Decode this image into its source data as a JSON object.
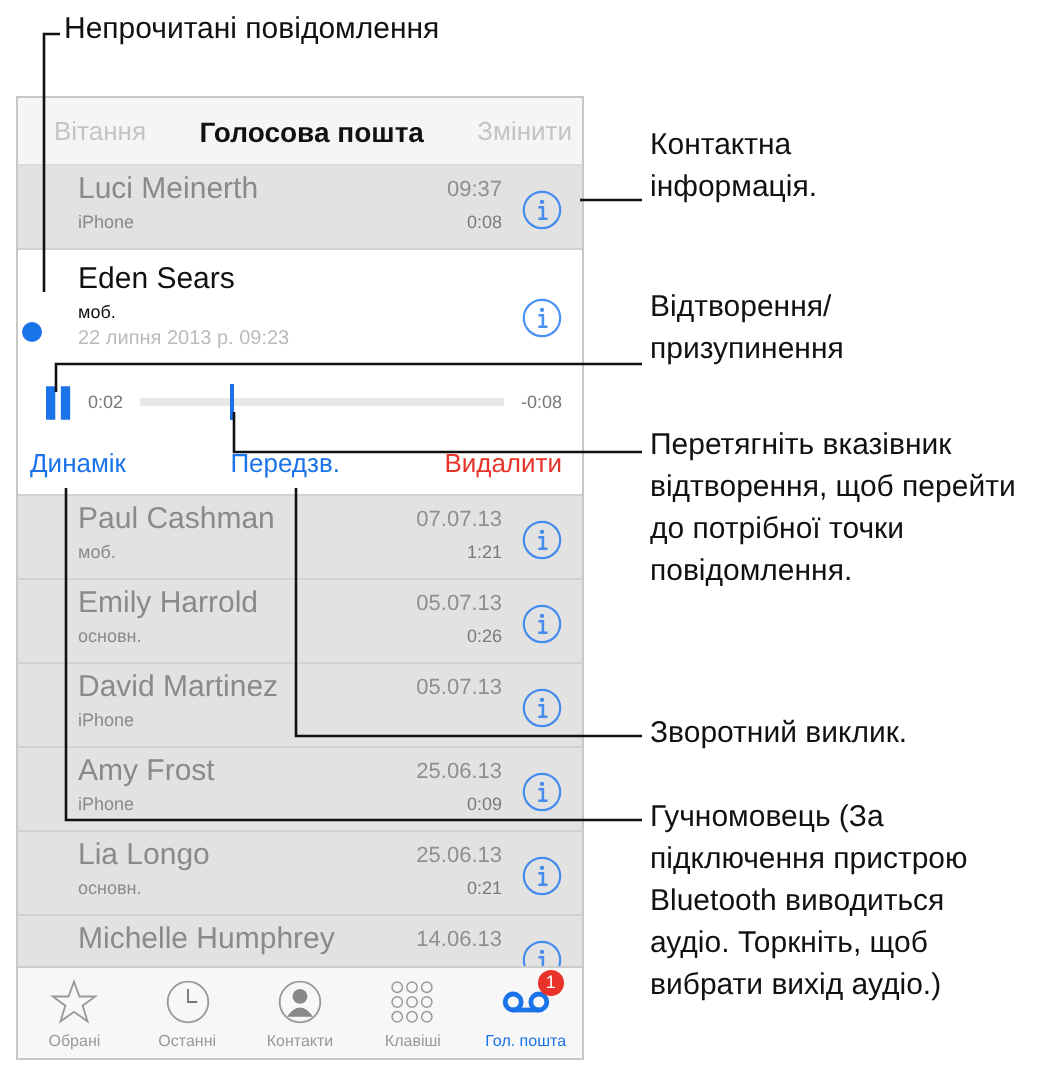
{
  "nav": {
    "left": "Вітання",
    "title": "Голосова пошта",
    "right": "Змінити"
  },
  "messages": [
    {
      "name": "Luci Meinerth",
      "label": "iPhone",
      "time": "09:37",
      "duration": "0:08",
      "unread": false,
      "selected": false
    },
    {
      "name": "Eden Sears",
      "label": "моб.",
      "date": "22 липня 2013 р. 09:23",
      "unread": true,
      "selected": true,
      "player": {
        "elapsed": "0:02",
        "remaining": "-0:08",
        "level": 0.25
      },
      "actions": [
        {
          "label": "Динамік",
          "kind": "normal"
        },
        {
          "label": "Передзв.",
          "kind": "normal"
        },
        {
          "label": "Видалити",
          "kind": "destructive"
        }
      ]
    },
    {
      "name": "Paul Cashman",
      "label": "моб.",
      "time": "07.07.13",
      "duration": "1:21",
      "unread": false,
      "selected": false
    },
    {
      "name": "Emily Harrold",
      "label": "основн.",
      "time": "05.07.13",
      "duration": "0:26",
      "unread": false,
      "selected": false
    },
    {
      "name": "David Martinez",
      "label": "iPhone",
      "time": "05.07.13",
      "unread": false,
      "selected": false
    },
    {
      "name": "Amy Frost",
      "label": "iPhone",
      "time": "25.06.13",
      "duration": "0:09",
      "unread": false,
      "selected": false
    },
    {
      "name": "Lia Longo",
      "label": "основн.",
      "time": "25.06.13",
      "duration": "0:21",
      "unread": false,
      "selected": false
    },
    {
      "name": "Michelle Humphrey",
      "time": "14.06.13",
      "unread": false,
      "selected": false
    }
  ],
  "tabs": [
    {
      "label": "Обрані",
      "kind": "favorites",
      "selected": false
    },
    {
      "label": "Останні",
      "kind": "recents",
      "selected": false
    },
    {
      "label": "Контакти",
      "kind": "contacts",
      "selected": false
    },
    {
      "label": "Клавіші",
      "kind": "keypad",
      "selected": false
    },
    {
      "label": "Гол. пошта",
      "kind": "voicemail",
      "selected": true,
      "badge": "1"
    }
  ],
  "callouts": [
    "Непрочитані повідомлення",
    "Контактна інформація.",
    "Відтворення/ призупинення",
    "Перетягніть вказівник відтворення, щоб перейти до потрібної точки повідомлення.",
    "Зворотний виклик.",
    "Гучномовець (За підключення пристрою Bluetooth виводиться аудіо. Торкніть, щоб вибрати вихід аудіо.)"
  ]
}
